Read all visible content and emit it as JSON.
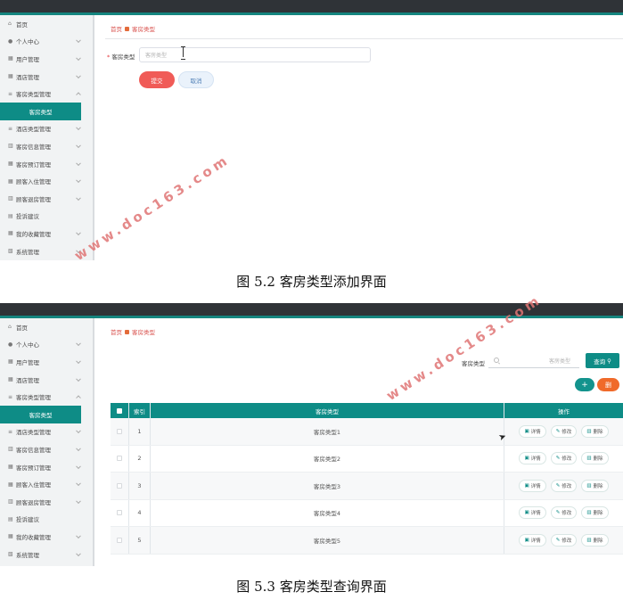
{
  "shot1": {
    "breadcrumb": {
      "home": "首页",
      "current": "客房类型"
    },
    "form": {
      "label": "客房类型",
      "required_mark": "*",
      "placeholder": "客房类型",
      "submit_label": "提交",
      "cancel_label": "取消"
    },
    "caption": "图 5.2 客房类型添加界面"
  },
  "shot2": {
    "breadcrumb": {
      "home": "首页",
      "current": "客房类型"
    },
    "search": {
      "label": "客房类型",
      "placeholder": "客房类型",
      "query_label": "查询",
      "add_label": "+",
      "delete_label": "删"
    },
    "table": {
      "headers": {
        "index": "索引",
        "type": "客房类型",
        "ops": "操作"
      },
      "rows": [
        {
          "index": "1",
          "type": "客房类型1"
        },
        {
          "index": "2",
          "type": "客房类型2"
        },
        {
          "index": "3",
          "type": "客房类型3"
        },
        {
          "index": "4",
          "type": "客房类型4"
        },
        {
          "index": "5",
          "type": "客房类型5"
        }
      ],
      "op_labels": {
        "detail": "详情",
        "edit": "修改",
        "delete": "删除"
      }
    },
    "caption": "图 5.3 客房类型查询界面"
  },
  "sidebar": {
    "items": [
      {
        "label": "首页",
        "icon": "home-icon"
      },
      {
        "label": "个人中心",
        "icon": "user-icon"
      },
      {
        "label": "用户管理",
        "icon": "grid-icon"
      },
      {
        "label": "酒店管理",
        "icon": "grid-icon"
      },
      {
        "label": "客房类型管理",
        "icon": "list-icon"
      },
      {
        "label": "客房类型",
        "icon": "",
        "active": true
      },
      {
        "label": "酒店类型管理",
        "icon": "list-icon"
      },
      {
        "label": "客房信息管理",
        "icon": "chart-icon"
      },
      {
        "label": "客房预订管理",
        "icon": "grid-icon"
      },
      {
        "label": "顾客入住管理",
        "icon": "grid-icon"
      },
      {
        "label": "顾客退房管理",
        "icon": "chart-icon"
      },
      {
        "label": "投诉建议",
        "icon": "chat-icon"
      },
      {
        "label": "我的收藏管理",
        "icon": "grid-icon"
      },
      {
        "label": "系统管理",
        "icon": "settings-icon"
      }
    ]
  },
  "watermark": "www.doc163.com",
  "colors": {
    "accent": "#0e8c86",
    "topbar": "#2f3337",
    "submit": "#f05b57",
    "delete": "#f06a2a",
    "crumb": "#d9534f"
  }
}
